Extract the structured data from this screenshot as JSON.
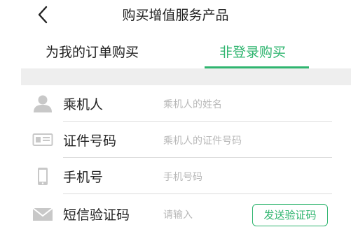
{
  "header": {
    "title": "购买增值服务产品"
  },
  "tabs": [
    {
      "label": "为我的订单购买",
      "active": false
    },
    {
      "label": "非登录购买",
      "active": true
    }
  ],
  "colors": {
    "accent": "#2fb56f",
    "icon": "#c8c8c8",
    "placeholder": "#b8b8b8"
  },
  "form": {
    "passenger": {
      "label": "乘机人",
      "placeholder": "乘机人的姓名",
      "icon": "person-icon"
    },
    "id_number": {
      "label": "证件号码",
      "placeholder": "乘机人的证件号码",
      "icon": "id-card-icon"
    },
    "phone": {
      "label": "手机号",
      "placeholder": "手机号码",
      "icon": "phone-icon"
    },
    "sms_code": {
      "label": "短信验证码",
      "placeholder": "请输入",
      "icon": "envelope-icon",
      "button_label": "发送验证码"
    }
  }
}
